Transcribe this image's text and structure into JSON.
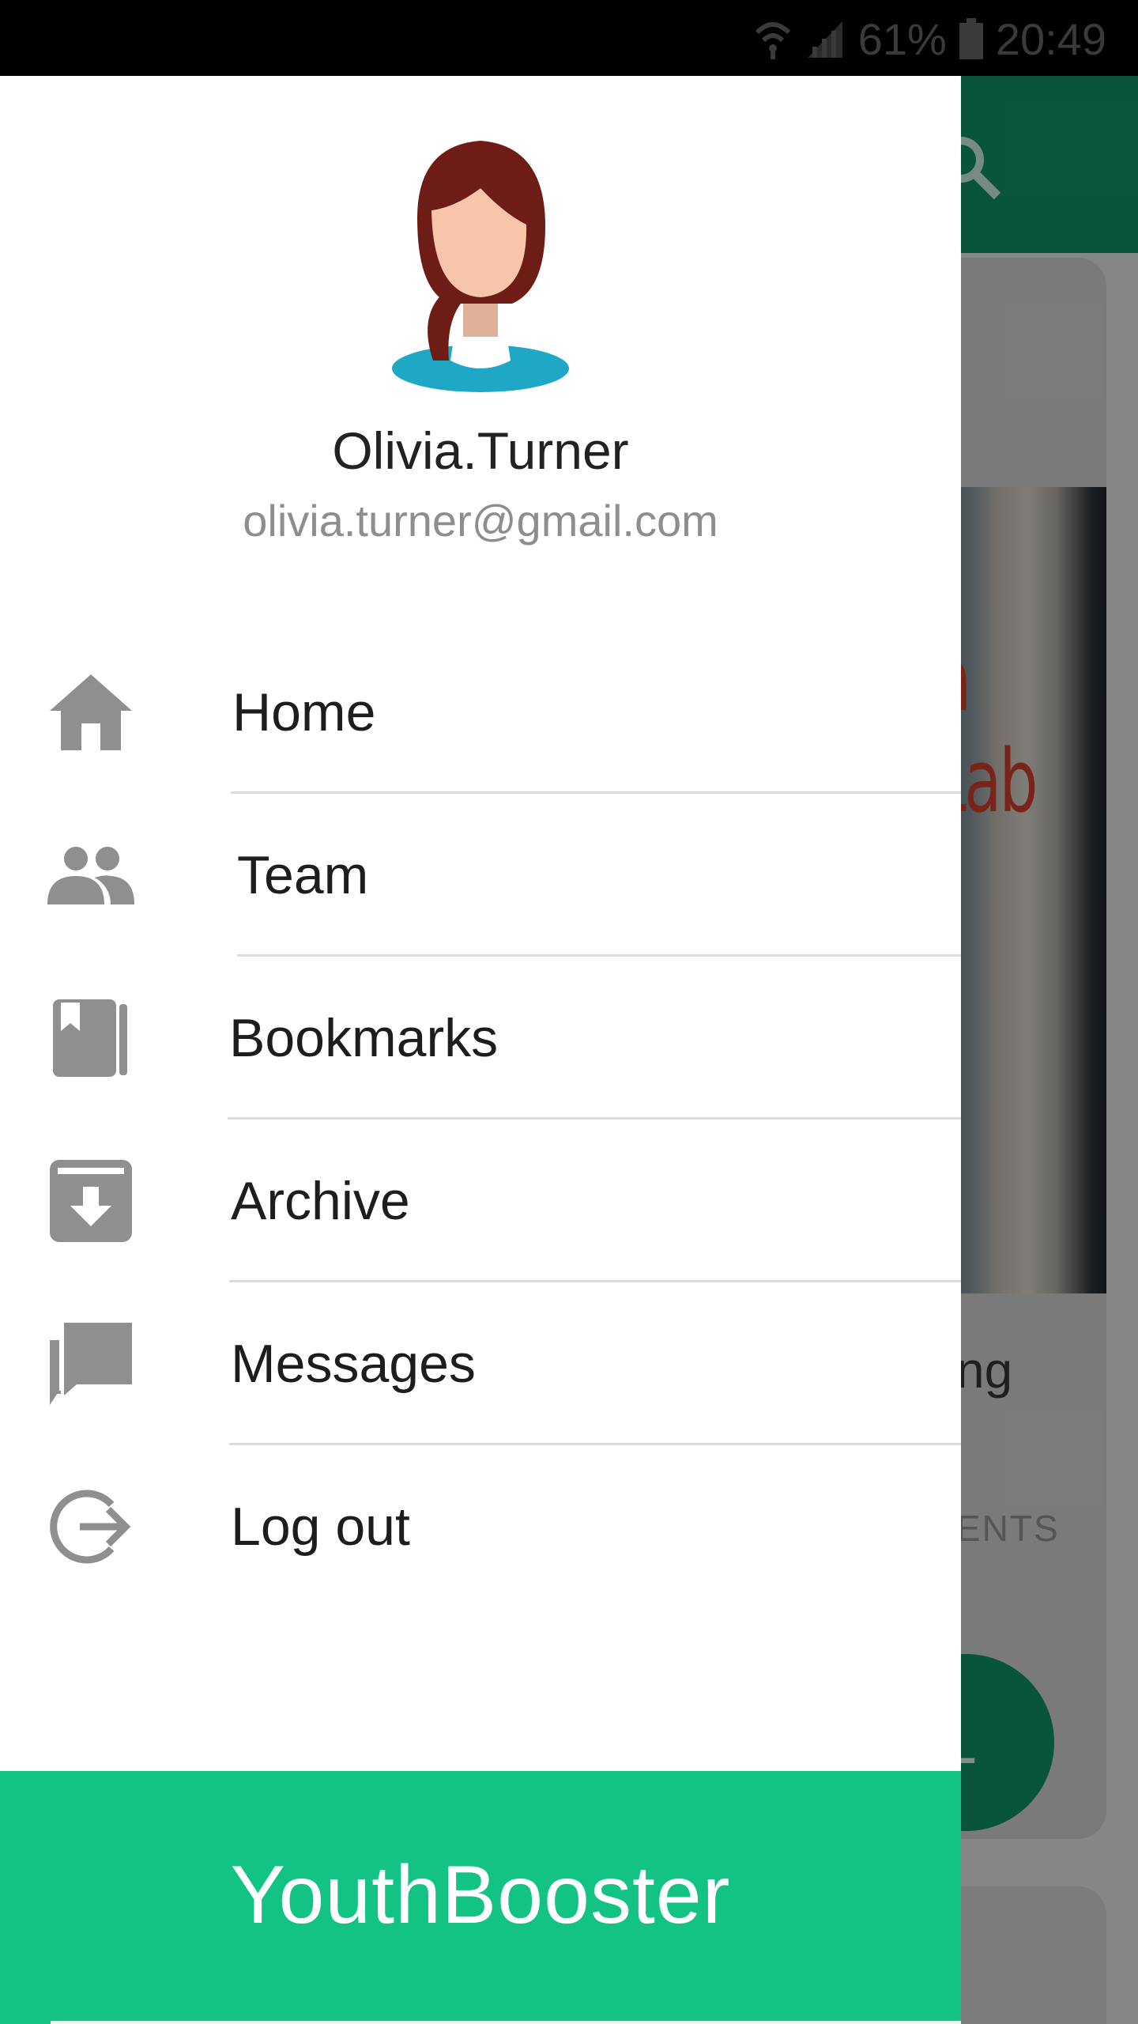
{
  "status_bar": {
    "battery": "61%",
    "time": "20:49",
    "icons": [
      "wifi-icon",
      "signal-icon",
      "battery-icon"
    ]
  },
  "background_app": {
    "card_image_text": "n Lab",
    "card_snippet": "ng",
    "card_caps": "ENTS",
    "fab_symbol": "+"
  },
  "drawer": {
    "user": {
      "name": "Olivia.Turner",
      "email": "olivia.turner@gmail.com"
    },
    "menu": [
      {
        "label": "Home",
        "icon": "home-icon"
      },
      {
        "label": "Team",
        "icon": "team-icon"
      },
      {
        "label": "Bookmarks",
        "icon": "bookmark-icon"
      },
      {
        "label": "Archive",
        "icon": "archive-icon"
      },
      {
        "label": "Messages",
        "icon": "messages-icon"
      },
      {
        "label": "Log out",
        "icon": "logout-icon"
      }
    ],
    "footer": {
      "brand": "YouthBooster"
    }
  },
  "colors": {
    "brand_green": "#12c384",
    "toolbar_green": "#0f8a5f",
    "icon_gray": "#8f8f8f"
  }
}
